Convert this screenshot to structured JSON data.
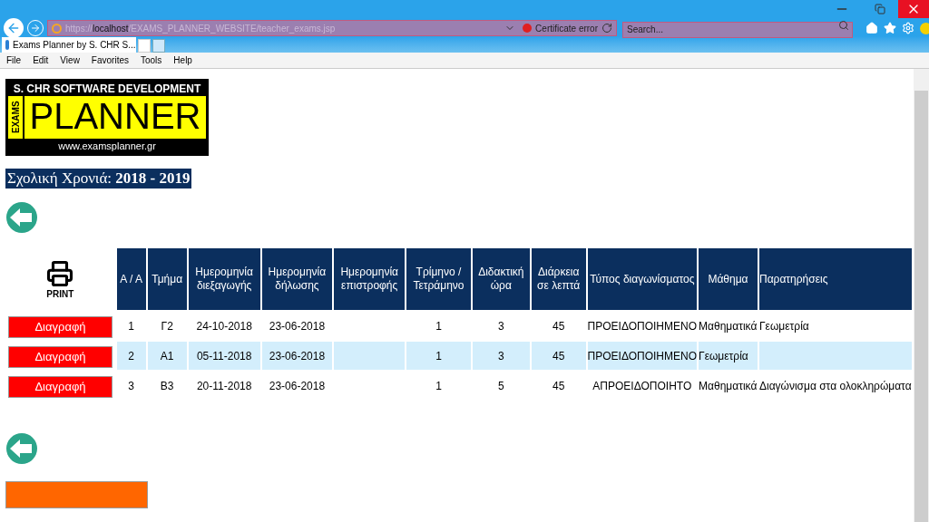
{
  "browser": {
    "url_host": "localhost",
    "url_scheme": "https://",
    "url_path": "/EXAMS_PLANNER_WEBSITE/teacher_exams.jsp",
    "certificate": "Certificate error",
    "search_placeholder": "Search...",
    "tab_title": "Exams Planner by S. CHR S...",
    "menu": [
      "File",
      "Edit",
      "View",
      "Favorites",
      "Tools",
      "Help"
    ]
  },
  "logo": {
    "company": "S. CHR SOFTWARE DEVELOPMENT",
    "side": "EXAMS",
    "title": "PLANNER",
    "website": "www.examsplanner.gr"
  },
  "school_year": {
    "label": "Σχολική Χρονιά:",
    "value": "2018 - 2019"
  },
  "print_label": "PRINT",
  "table": {
    "columns": [
      "Α / Α",
      "Τμήμα",
      "Ημερομηνία διεξαγωγής",
      "Ημερομηνία δήλωσης",
      "Ημερομηνία επιστροφής",
      "Τρίμηνο / Τετράμηνο",
      "Διδακτική ώρα",
      "Διάρκεια σε λεπτά",
      "Τύπος διαγωνίσματος",
      "Μάθημα",
      "Παρατηρήσεις"
    ],
    "rows": [
      {
        "action": "Διαγραφή",
        "highlighted": false,
        "cells": [
          "1",
          "Γ2",
          "24-10-2018",
          "23-06-2018",
          "",
          "1",
          "3",
          "45",
          "ΠΡΟΕΙΔΟΠΟΙΗΜΕΝΟ",
          "Μαθηματικά",
          "Γεωμετρία"
        ]
      },
      {
        "action": "Διαγραφή",
        "highlighted": true,
        "cells": [
          "2",
          "Α1",
          "05-11-2018",
          "23-06-2018",
          "",
          "1",
          "3",
          "45",
          "ΠΡΟΕΙΔΟΠΟΙΗΜΕΝΟ",
          "Γεωμετρία",
          ""
        ]
      },
      {
        "action": "Διαγραφή",
        "highlighted": false,
        "cells": [
          "3",
          "Β3",
          "20-11-2018",
          "23-06-2018",
          "",
          "1",
          "5",
          "45",
          "ΑΠΡΟΕΙΔΟΠΟΙΗΤΟ",
          "Μαθηματικά",
          "Διαγώνισμα στα ολοκληρώματα"
        ]
      }
    ]
  }
}
